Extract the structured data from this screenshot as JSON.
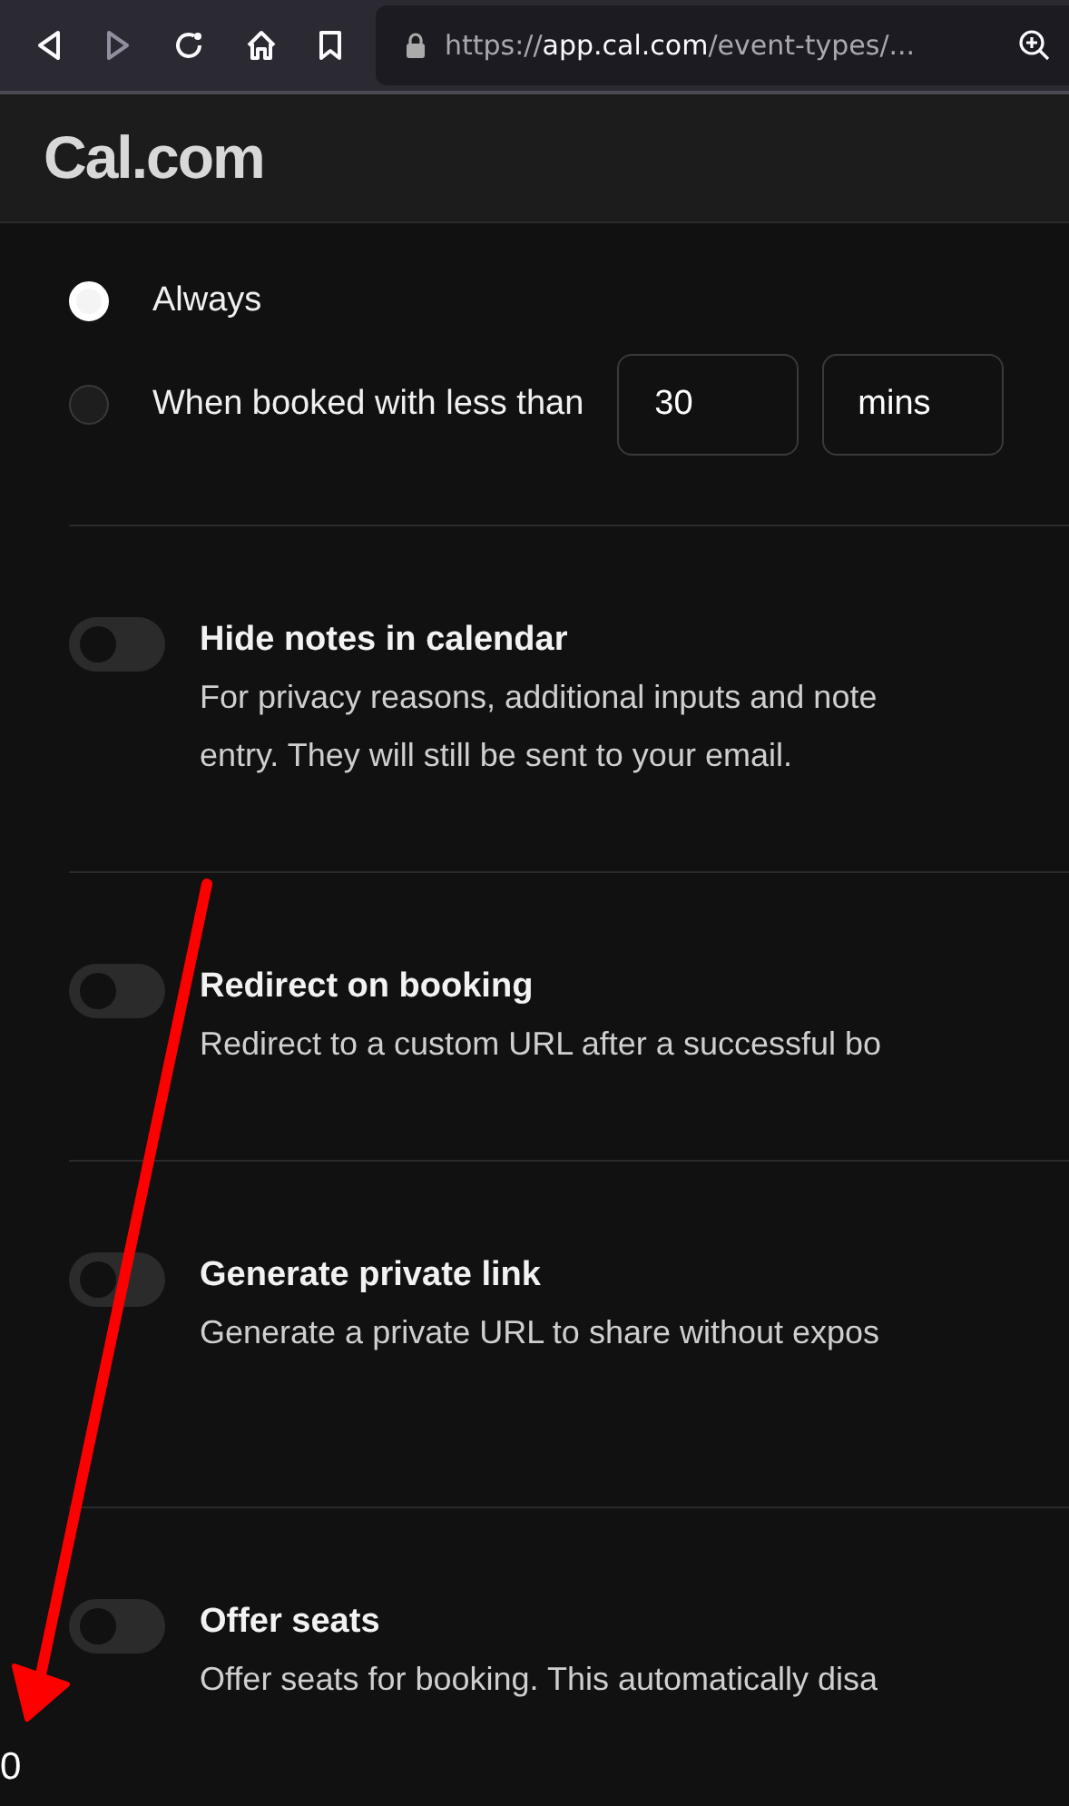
{
  "browser": {
    "url_scheme": "https://",
    "url_host": "app.cal.com",
    "url_path": "/event-types/..."
  },
  "header": {
    "logo": "Cal.com"
  },
  "radio_options": [
    {
      "label": "Always",
      "selected": true,
      "kind": "plain"
    },
    {
      "label": "When booked with less than",
      "selected": false,
      "kind": "threshold",
      "amount": "30",
      "unit": "mins"
    }
  ],
  "settings": [
    {
      "title": "Hide notes in calendar",
      "description": "For privacy reasons, additional inputs and note",
      "description_2": "entry. They will still be sent to your email.",
      "on": false
    },
    {
      "title": "Redirect on booking",
      "description": "Redirect to a custom URL after a successful bo",
      "on": false
    },
    {
      "title": "Generate private link",
      "description": "Generate a private URL to share without expos",
      "on": false
    },
    {
      "title": "Offer seats",
      "description": "Offer seats for booking. This automatically disa",
      "on": false
    }
  ],
  "footer_text": "0"
}
